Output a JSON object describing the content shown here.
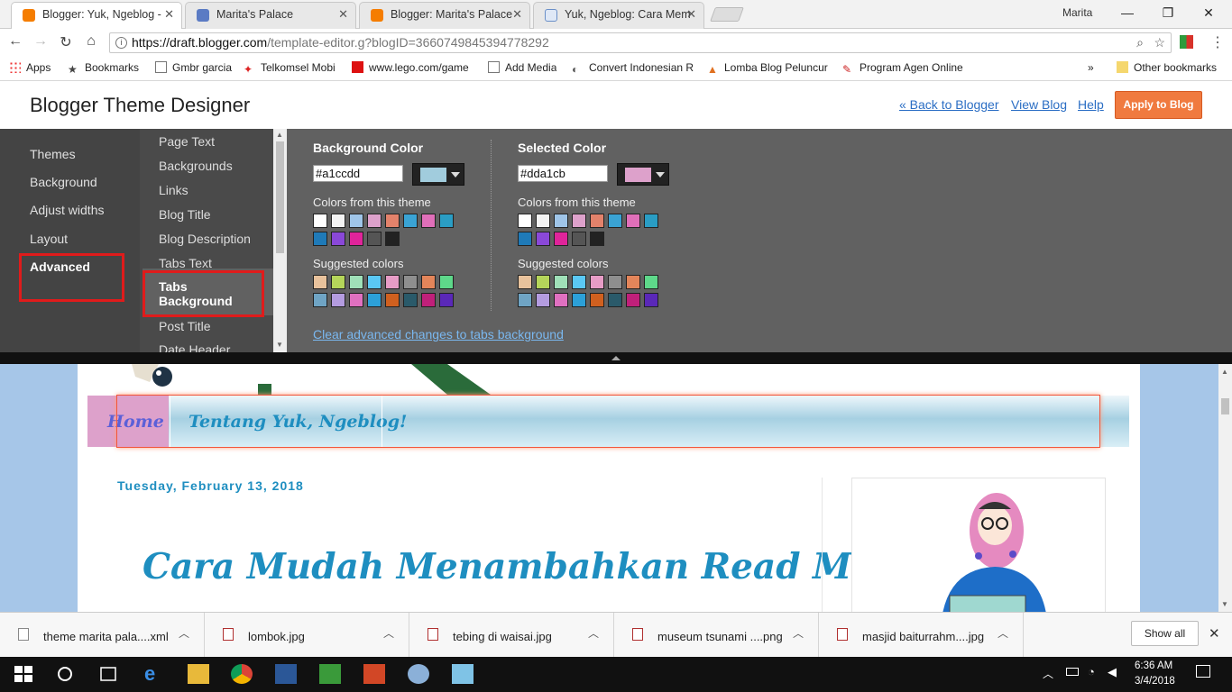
{
  "browser": {
    "tabs": [
      {
        "title": "Blogger: Yuk, Ngeblog -",
        "active": true,
        "icon": "blogger-icon"
      },
      {
        "title": "Marita's Palace",
        "active": false,
        "icon": "page-icon"
      },
      {
        "title": "Blogger: Marita's Palace",
        "active": false,
        "icon": "blogger-icon"
      },
      {
        "title": "Yuk, Ngeblog: Cara Mem",
        "active": false,
        "icon": "page-icon"
      }
    ],
    "profile_name": "Marita",
    "url_base": "https://draft.blogger.com",
    "url_rest": "/template-editor.g?blogID=3660749845394778292",
    "bookmarks": [
      "Apps",
      "Bookmarks",
      "Gmbr garcia",
      "Telkomsel Mobi",
      "www.lego.com/game",
      "Add Media",
      "Convert Indonesian R",
      "Lomba Blog Peluncur",
      "Program Agen Online"
    ],
    "bookmarks_more": "»",
    "other_bookmarks": "Other bookmarks"
  },
  "header": {
    "title": "Blogger Theme Designer",
    "back_link": "« Back to Blogger",
    "view_blog": "View Blog",
    "help": "Help",
    "apply": "Apply to Blog"
  },
  "designer": {
    "nav": [
      "Themes",
      "Background",
      "Adjust widths",
      "Layout",
      "Advanced"
    ],
    "active_nav": "Advanced",
    "subnav": [
      "Page Text",
      "Backgrounds",
      "Links",
      "Blog Title",
      "Blog Description",
      "Tabs Text",
      "Tabs Background",
      "Post Title",
      "Date Header"
    ],
    "active_subnav": "Tabs Background",
    "background_color": {
      "label": "Background Color",
      "value": "#a1ccdd",
      "theme_label": "Colors from this theme",
      "suggested_label": "Suggested colors"
    },
    "selected_color": {
      "label": "Selected Color",
      "value": "#dda1cb",
      "theme_label": "Colors from this theme",
      "suggested_label": "Suggested colors"
    },
    "theme_colors": [
      "#ffffff",
      "#f3f3f3",
      "#9fc5e8",
      "#dda1cb",
      "#e3826b",
      "#3aa3d4",
      "#e06fb9",
      "#2a9dc4",
      "#1f7ab8",
      "#8a48d8",
      "#e0249a",
      "#555555",
      "#222222"
    ],
    "suggested_colors": [
      "#e8c29c",
      "#b5d55a",
      "#9fe0b8",
      "#5ac8f5",
      "#e79cc6",
      "#8e8e8e",
      "#e3855a",
      "#5ed88a",
      "#6fa4c4",
      "#b49ce0",
      "#e070c0",
      "#2ca0d8",
      "#d0601f",
      "#2a5a6a",
      "#c0207a",
      "#5a28b8"
    ],
    "clear_link": "Clear advanced changes to tabs background"
  },
  "preview": {
    "tabs": [
      "Home",
      "Tentang Yuk, Ngeblog!"
    ],
    "date": "Tuesday, February 13, 2018",
    "post_title": "Cara Mudah Menambahkan Read More"
  },
  "downloads": {
    "items": [
      "theme marita pala....xml",
      "lombok.jpg",
      "tebing di waisai.jpg",
      "museum tsunami ....png",
      "masjid baiturrahm....jpg"
    ],
    "show_all": "Show all"
  },
  "taskbar": {
    "time": "6:36 AM",
    "date": "3/4/2018"
  }
}
